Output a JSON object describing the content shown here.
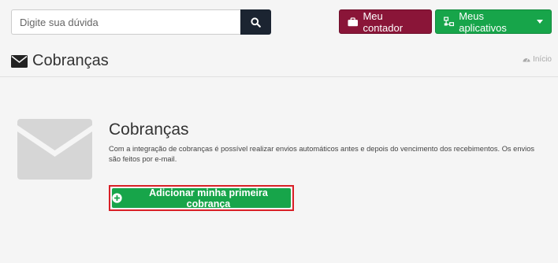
{
  "search": {
    "placeholder": "Digite sua dúvida"
  },
  "toolbar": {
    "contador_label": "Meu contador",
    "apps_label": "Meus aplicativos",
    "contador_color": "#8a1538",
    "apps_color": "#17a54a"
  },
  "header": {
    "title": "Cobranças",
    "title_icon": "envelope-icon",
    "breadcrumb_label": "Início",
    "breadcrumb_icon": "dashboard-icon"
  },
  "empty_state": {
    "icon": "envelope-icon",
    "title": "Cobranças",
    "description": "Com a integração de cobranças é possível realizar envios automáticos antes e depois do vencimento dos recebimentos. Os envios são feitos por e-mail.",
    "cta_label": "Adicionar minha primeira cobrança",
    "cta_icon": "plus-circle-icon",
    "highlight_color": "#d92027"
  }
}
